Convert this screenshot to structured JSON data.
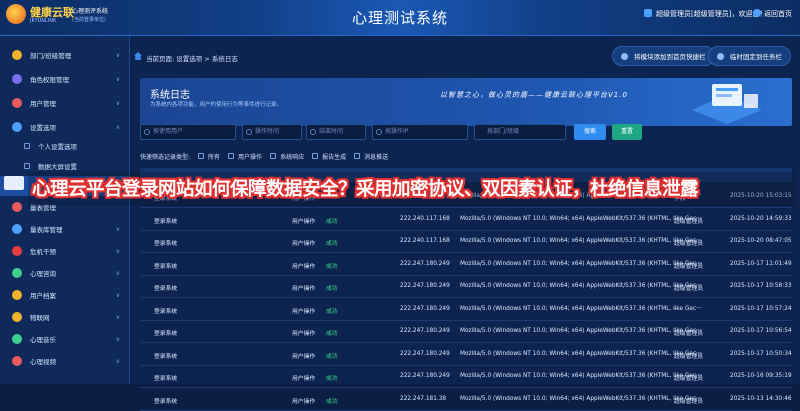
{
  "header": {
    "brand": "健康云联",
    "brand_en": "JKYUNLINK",
    "system_line1": "心理测评系统",
    "system_line2": "(当前登录单位)",
    "title": "心理测试系统",
    "user": "超级管理员[超级管理员]，欢迎您！",
    "back": "返回首页"
  },
  "sidebar": {
    "items": [
      {
        "label": "部门/班级管理",
        "color": "#f0b429",
        "y": 0
      },
      {
        "label": "角色权限管理",
        "color": "#7c6cf2",
        "y": 1
      },
      {
        "label": "用户管理",
        "color": "#e85a5a",
        "y": 2
      },
      {
        "label": "设置选项",
        "color": "#4ca0ff",
        "y": 3
      }
    ],
    "subitems": [
      {
        "label": "个人设置选项"
      },
      {
        "label": "数据大屏设置"
      }
    ],
    "lower": [
      {
        "label": "量表管理",
        "color": "#e85a5a"
      },
      {
        "label": "量表库管理",
        "color": "#4ca0ff"
      },
      {
        "label": "危机干预",
        "color": "#e83b3b"
      },
      {
        "label": "心理咨询",
        "color": "#3ecf8e"
      },
      {
        "label": "用户档案",
        "color": "#f0b429"
      },
      {
        "label": "物联网",
        "color": "#f0b429"
      },
      {
        "label": "心理音乐",
        "color": "#3ecf8e"
      },
      {
        "label": "心理视频",
        "color": "#e85a5a"
      }
    ]
  },
  "breadcrumb": "当前页面: 设置选项 > 系统日志",
  "quick": {
    "add": "将模块添加到首页快捷栏",
    "fix": "临时固定到任务栏"
  },
  "banner": {
    "title": "系统日志",
    "subtitle": "为系统内各项功能，用户的使用行为等事件进行记录。",
    "slogan": "以智慧之心，做心灵的盾——健康云联心理平台V1.0"
  },
  "filters": {
    "user_placeholder": "按使用用户",
    "start_placeholder": "操作时间",
    "end_placeholder": "结束时间",
    "ip_placeholder": "按操作IP",
    "dept_placeholder": "按部门/班级",
    "search": "搜索",
    "reset": "重置"
  },
  "quick_filter": {
    "label": "快速筛选记录类型:",
    "options": [
      "所有",
      "用户操作",
      "系统响应",
      "报告生成",
      "消息推送"
    ]
  },
  "table": {
    "rows": [
      {
        "module": "登录系统",
        "type": "用户操作",
        "status": "",
        "ip": "123.4.101.154",
        "agent": "Mozilla/5.0 (Windows NT 10.0; Win64; x64) AppleWebKit/537.36 (KHTML, like Gec···",
        "user": "李欣",
        "time": "2025-10-20 15:03:15"
      },
      {
        "module": "登录系统",
        "type": "用户操作",
        "status": "成功",
        "ip": "222.240.117.168",
        "agent": "Mozilla/5.0 (Windows NT 10.0; Win64; x64) AppleWebKit/537.36 (KHTML, like Gec···",
        "user": "超级管理员",
        "time": "2025-10-20 14:59:33"
      },
      {
        "module": "登录系统",
        "type": "用户操作",
        "status": "成功",
        "ip": "222.240.117.168",
        "agent": "Mozilla/5.0 (Windows NT 10.0; Win64; x64) AppleWebKit/537.36 (KHTML, like Gec···",
        "user": "超级管理员",
        "time": "2025-10-20 08:47:05"
      },
      {
        "module": "登录系统",
        "type": "用户操作",
        "status": "成功",
        "ip": "222.247.180.249",
        "agent": "Mozilla/5.0 (Windows NT 10.0; Win64; x64) AppleWebKit/537.36 (KHTML, like Gec···",
        "user": "超级管理员",
        "time": "2025-10-17 11:01:49"
      },
      {
        "module": "登录系统",
        "type": "用户操作",
        "status": "成功",
        "ip": "222.247.180.249",
        "agent": "Mozilla/5.0 (Windows NT 10.0; Win64; x64) AppleWebKit/537.36 (KHTML, like Gec···",
        "user": "超级管理员",
        "time": "2025-10-17 10:58:33"
      },
      {
        "module": "登录系统",
        "type": "用户操作",
        "status": "成功",
        "ip": "222.247.180.249",
        "agent": "Mozilla/5.0 (Windows NT 10.0; Win64; x64) AppleWebKit/537.36 (KHTML, like Gec···",
        "user": "--",
        "time": "2025-10-17 10:57:24"
      },
      {
        "module": "登录系统",
        "type": "用户操作",
        "status": "成功",
        "ip": "222.247.180.249",
        "agent": "Mozilla/5.0 (Windows NT 10.0; Win64; x64) AppleWebKit/537.36 (KHTML, like Gec···",
        "user": "超级管理员",
        "time": "2025-10-17 10:56:54"
      },
      {
        "module": "登录系统",
        "type": "用户操作",
        "status": "成功",
        "ip": "222.247.180.249",
        "agent": "Mozilla/5.0 (Windows NT 10.0; Win64; x64) AppleWebKit/537.36 (KHTML, like Gec···",
        "user": "超级管理员",
        "time": "2025-10-17 10:50:34"
      },
      {
        "module": "登录系统",
        "type": "用户操作",
        "status": "成功",
        "ip": "222.247.180.249",
        "agent": "Mozilla/5.0 (Windows NT 10.0; Win64; x64) AppleWebKit/537.36 (KHTML, like Gec···",
        "user": "超级管理员",
        "time": "2025-10-16 09:35:19"
      },
      {
        "module": "登录系统",
        "type": "用户操作",
        "status": "成功",
        "ip": "222.247.181.38",
        "agent": "Mozilla/5.0 (Windows NT 10.0; Win64; x64) AppleWebKit/537.36 (KHTML, like Gec···",
        "user": "超级管理员",
        "time": "2025-10-13 14:30:46"
      }
    ]
  },
  "overlay": {
    "text": "心理云平台登录网站如何保障数据安全？采用加密协议、双因素认证，杜绝信息泄露"
  }
}
